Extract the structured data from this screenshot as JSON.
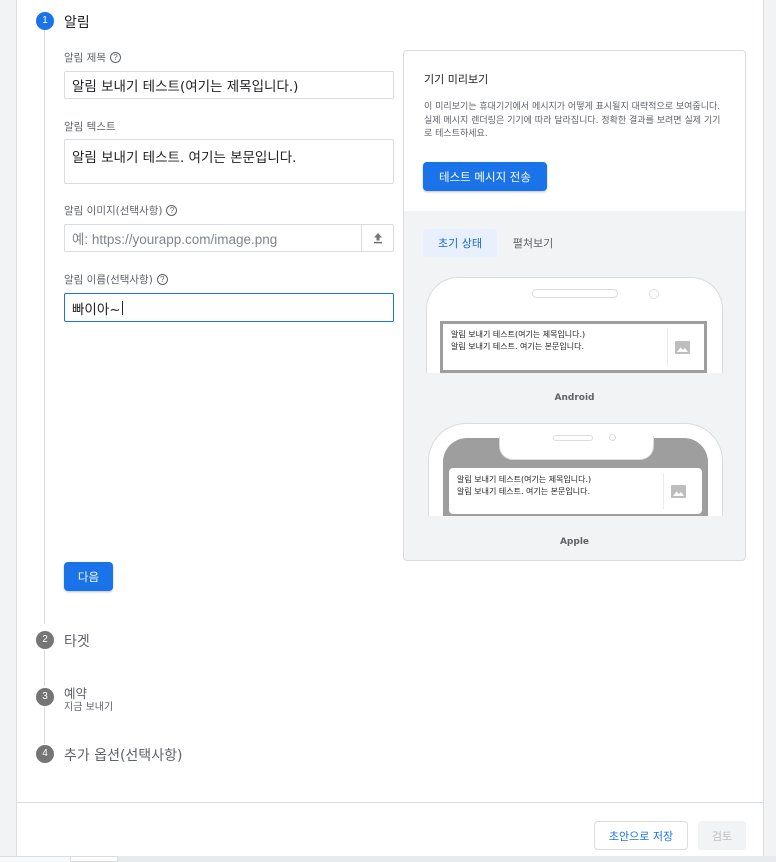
{
  "steps": [
    {
      "number": "1",
      "title": "알림",
      "subtitle": ""
    },
    {
      "number": "2",
      "title": "타겟",
      "subtitle": ""
    },
    {
      "number": "3",
      "title": "예약",
      "subtitle": "지금 보내기"
    },
    {
      "number": "4",
      "title": "추가 옵션(선택사항)",
      "subtitle": ""
    }
  ],
  "form": {
    "title_label": "알림 제목",
    "title_value": "알림 보내기 테스트(여기는 제목입니다.)",
    "text_label": "알림 텍스트",
    "text_value": "알림 보내기 테스트. 여기는 본문입니다.",
    "image_label": "알림 이미지(선택사항)",
    "image_placeholder": "예: https://yourapp.com/image.png",
    "name_label": "알림 이름(선택사항)",
    "name_value": "빠이아~",
    "help_glyph": "?",
    "next_button": "다음"
  },
  "preview": {
    "title": "기기 미리보기",
    "description": "이 미리보기는 휴대기기에서 메시지가 어떻게 표시될지 대략적으로 보여줍니다. 실제 메시지 렌더링은 기기에 따라 달라집니다. 정확한 결과를 보려면 실제 기기로 테스트하세요.",
    "test_button": "테스트 메시지 전송",
    "tabs": [
      "초기 상태",
      "펼쳐보기"
    ],
    "selected_tab": "초기 상태",
    "notification_title": "알림 보내기 테스트(여기는 제목입니다.)",
    "notification_body": "알림 보내기 테스트. 여기는 본문입니다.",
    "android_label": "Android",
    "apple_label": "Apple"
  },
  "footer": {
    "save_draft": "초안으로 저장",
    "review": "검토"
  },
  "colors": {
    "accent": "#1a73e8",
    "step_inactive": "#757575",
    "border": "#dadce0"
  }
}
